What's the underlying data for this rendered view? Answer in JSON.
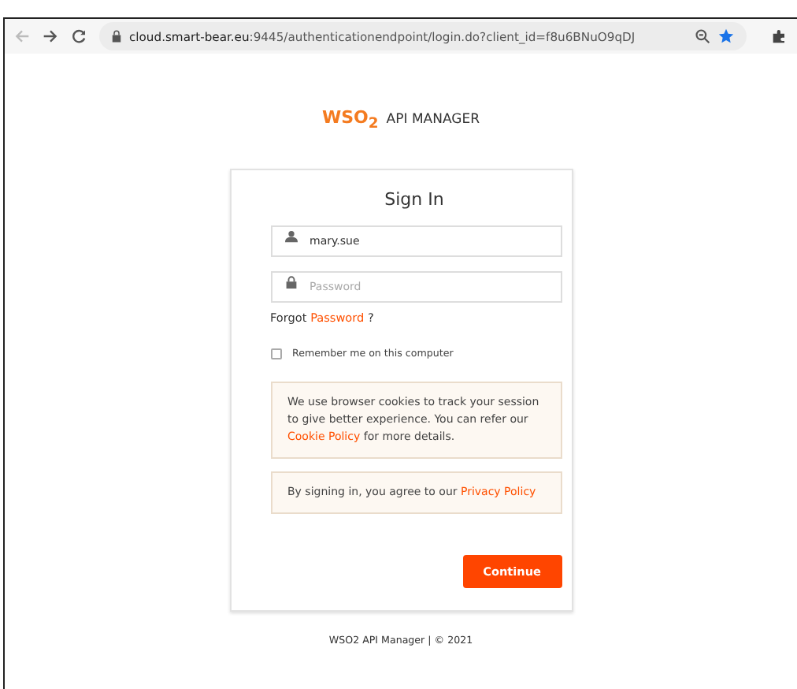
{
  "browser": {
    "url_host": "cloud.smart-bear.eu",
    "url_rest": ":9445/authenticationendpoint/login.do?client_id=f8u6BNuO9qDJ"
  },
  "logo": {
    "brand": "WSO$_{2}$",
    "product": "API MANAGER"
  },
  "form": {
    "title": "Sign In",
    "username": {
      "value": "mary.sue"
    },
    "password": {
      "placeholder": "Password"
    },
    "forgot": {
      "before": "Forgot",
      "link": "Password",
      "after": "?"
    },
    "remember": {
      "label": "Remember me on this computer",
      "checked": false
    },
    "cookie_notice": {
      "before": "We use browser cookies to track your session to give better experience. You can refer our",
      "link": "Cookie Policy",
      "after": "for more details."
    },
    "privacy_notice": {
      "before": "By signing in, you agree to our",
      "link": "Privacy Policy"
    },
    "submit": "Continue"
  },
  "footer": "WSO2 API Manager | © 2021"
}
